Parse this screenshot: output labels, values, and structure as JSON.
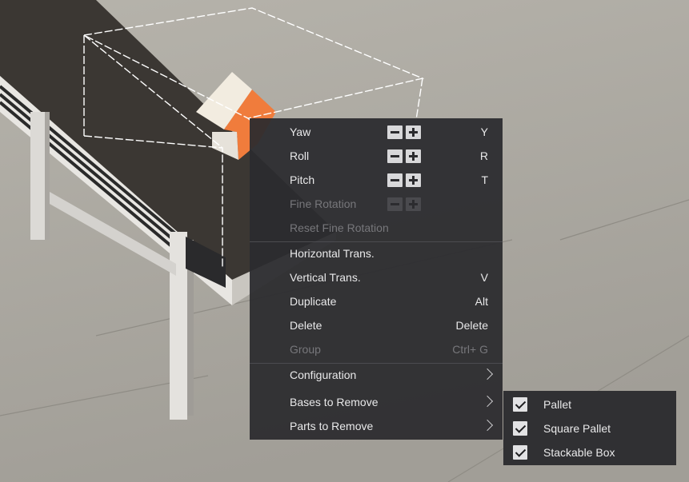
{
  "menu": {
    "items": [
      {
        "label": "Yaw",
        "shortcut": "Y"
      },
      {
        "label": "Roll",
        "shortcut": "R"
      },
      {
        "label": "Pitch",
        "shortcut": "T"
      },
      {
        "label": "Fine Rotation",
        "shortcut": ""
      },
      {
        "label": "Reset Fine Rotation",
        "shortcut": ""
      },
      {
        "label": "Horizontal Trans.",
        "shortcut": ""
      },
      {
        "label": "Vertical Trans.",
        "shortcut": "V"
      },
      {
        "label": "Duplicate",
        "shortcut": "Alt"
      },
      {
        "label": "Delete",
        "shortcut": "Delete"
      },
      {
        "label": "Group",
        "shortcut": "Ctrl+ G"
      },
      {
        "label": "Configuration",
        "shortcut": ""
      },
      {
        "label": "Bases to Remove",
        "shortcut": ""
      },
      {
        "label": "Parts to Remove",
        "shortcut": ""
      }
    ]
  },
  "submenu": {
    "items": [
      {
        "label": "Pallet",
        "checked": true
      },
      {
        "label": "Square Pallet",
        "checked": true
      },
      {
        "label": "Stackable Box",
        "checked": true
      }
    ]
  },
  "colors": {
    "menu_bg": "#2c2c2f",
    "box_orange": "#f07c3c",
    "conveyor_belt": "#3c3834"
  }
}
